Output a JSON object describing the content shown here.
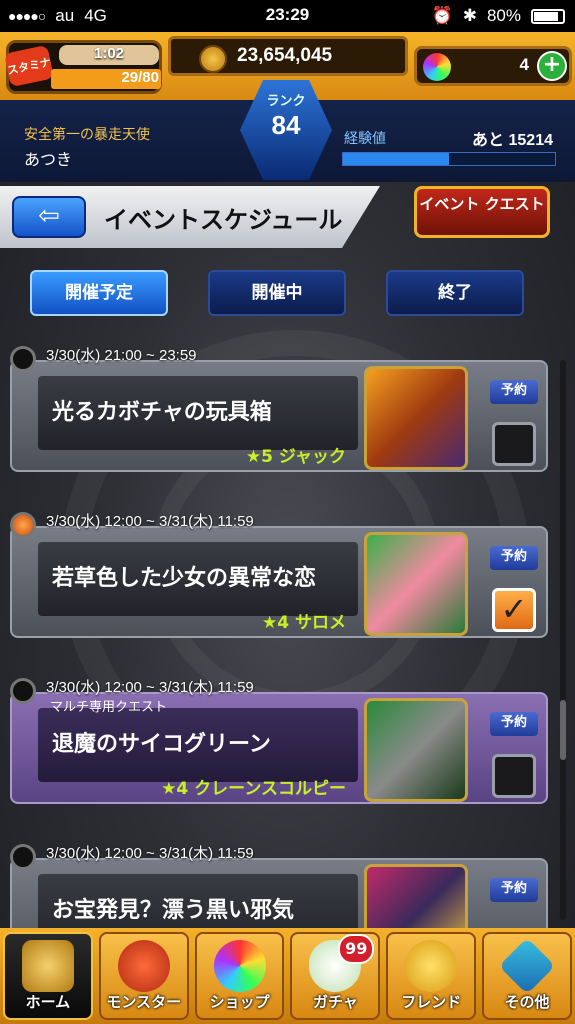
{
  "status_bar": {
    "carrier": "au",
    "network": "4G",
    "time": "23:29",
    "battery": "80%"
  },
  "header": {
    "stamina_icon_label": "スタミナ",
    "stamina_timer": "1:02",
    "stamina": "29/80",
    "gold": "23,654,045",
    "orbs": "4",
    "rank_label": "ランク",
    "rank": "84",
    "player_title": "安全第一の暴走天使",
    "player_name": "あつき",
    "exp_label": "経験値",
    "exp_remaining": "あと 15214"
  },
  "title_bar": {
    "title": "イベントスケジュール",
    "event_quest_button": "イベント クエスト"
  },
  "tabs": [
    {
      "label": "開催予定",
      "active": true
    },
    {
      "label": "開催中",
      "active": false
    },
    {
      "label": "終了",
      "active": false
    }
  ],
  "events": [
    {
      "date": "3/30(水) 21:00 ~ 23:59",
      "subtitle": "",
      "name": "光るカボチャの玩具箱",
      "monster": "★5 ジャック",
      "reserve_label": "予約",
      "reserved": false,
      "multi": false,
      "live": false
    },
    {
      "date": "3/30(水) 12:00 ~ 3/31(木) 11:59",
      "subtitle": "",
      "name": "若草色した少女の異常な恋",
      "monster": "★4 サロメ",
      "reserve_label": "予約",
      "reserved": true,
      "multi": false,
      "live": true
    },
    {
      "date": "3/30(水) 12:00 ~ 3/31(木) 11:59",
      "subtitle": "マルチ専用クエスト",
      "name": "退魔のサイコグリーン",
      "monster": "★4 クレーンスコルピー",
      "reserve_label": "予約",
      "reserved": false,
      "multi": true,
      "live": false
    },
    {
      "date": "3/30(水) 12:00 ~ 3/31(木) 11:59",
      "subtitle": "",
      "name": "お宝発見？漂う黒い邪気",
      "monster": "",
      "reserve_label": "予約",
      "reserved": false,
      "multi": false,
      "live": false
    }
  ],
  "bottom_nav": [
    {
      "label": "ホーム",
      "icon": "home-icon",
      "active": true
    },
    {
      "label": "モンスター",
      "icon": "monster-icon",
      "active": false
    },
    {
      "label": "ショップ",
      "icon": "shop-orb-icon",
      "active": false
    },
    {
      "label": "ガチャ",
      "icon": "gacha-egg-icon",
      "badge": "99",
      "active": false
    },
    {
      "label": "フレンド",
      "icon": "friend-icon",
      "active": false
    },
    {
      "label": "その他",
      "icon": "other-icon",
      "active": false
    }
  ],
  "colors": {
    "gold_frame": "#f5b12a",
    "tab_active": "#3a9cff",
    "multi_card": "#8a6fb2",
    "monster_label": "#c7f028"
  }
}
